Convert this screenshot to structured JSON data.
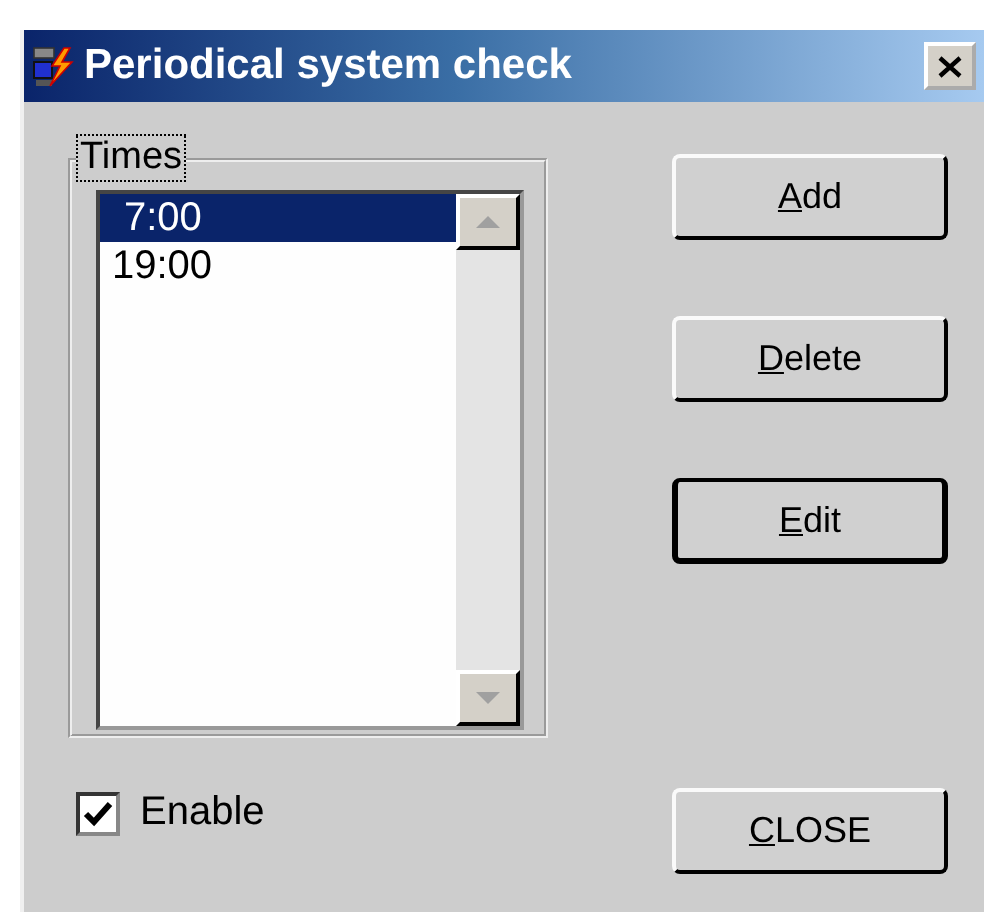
{
  "window": {
    "title": "Periodical system check"
  },
  "times_group": {
    "label": "Times",
    "focused": true,
    "items": [
      {
        "label": "7:00",
        "selected": true
      },
      {
        "label": "19:00",
        "selected": false
      }
    ]
  },
  "enable": {
    "label": "Enable",
    "checked": true
  },
  "buttons": [
    {
      "label": "Add",
      "access_key": true,
      "default": false
    },
    {
      "label": "Delete",
      "access_key": true,
      "default": false
    },
    {
      "label": "Edit",
      "access_key": true,
      "default": true
    },
    {
      "label": "CLOSE",
      "access_key": true,
      "default": false
    }
  ]
}
